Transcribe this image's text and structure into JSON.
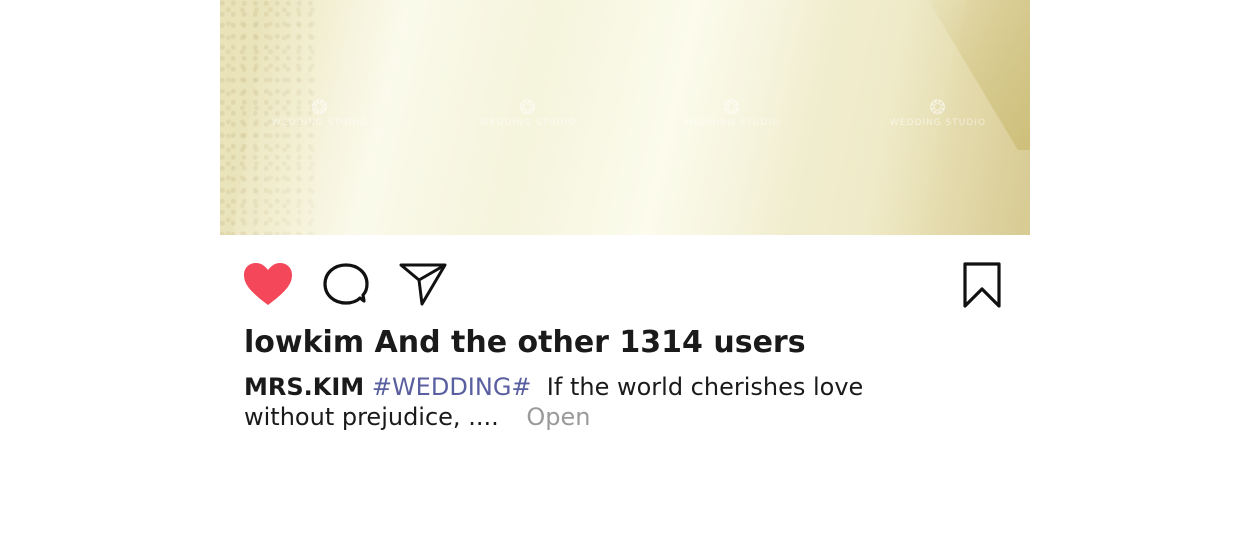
{
  "post": {
    "photo_alt": "",
    "watermark_text": "WEDDING STUDIO",
    "likes_text": "lowkim And the other 1314 users",
    "caption": {
      "username": "MRS.KIM",
      "hashtag": "#WEDDING#",
      "text": "If the world cherishes love without prejudice, ....",
      "more_label": "Open"
    }
  },
  "icons": {
    "like": "heart-filled-icon",
    "comment": "comment-bubble-icon",
    "share": "paper-plane-icon",
    "save": "bookmark-icon"
  },
  "colors": {
    "like_active": "#f4475a",
    "hashtag": "#5a5fa0",
    "more_link": "#9a9a9a",
    "text": "#1a1a1a"
  }
}
